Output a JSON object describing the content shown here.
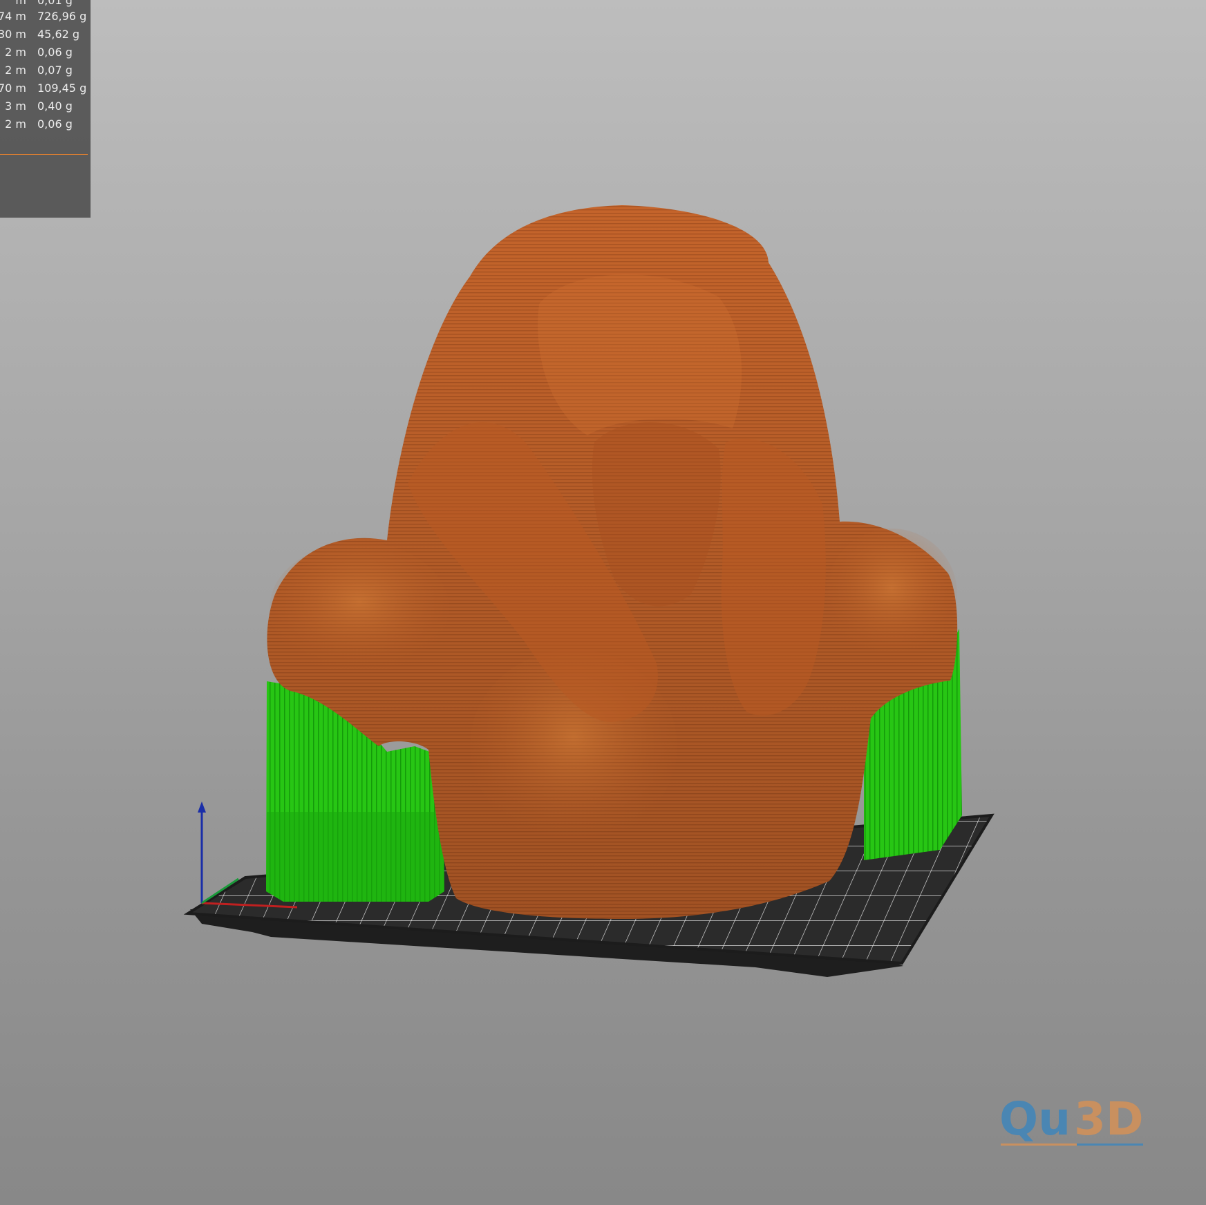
{
  "statistics_panel": {
    "rows": [
      {
        "length": "m",
        "weight": "0,01 g"
      },
      {
        "length": ",74 m",
        "weight": "726,96 g"
      },
      {
        "length": "30 m",
        "weight": "45,62 g"
      },
      {
        "length": "2 m",
        "weight": "0,06 g"
      },
      {
        "length": "2 m",
        "weight": "0,07 g"
      },
      {
        "length": "70 m",
        "weight": "109,45 g"
      },
      {
        "length": "3 m",
        "weight": "0,40 g"
      },
      {
        "length": "2 m",
        "weight": "0,06 g"
      }
    ],
    "separator_color": "#e2802f"
  },
  "viewport": {
    "object": "sliced-bust-preview",
    "colors": {
      "perimeter": "#c8642a",
      "support": "#22c20f",
      "bed": "#2b2b2b",
      "grid": "#e8e8e8",
      "axis_z": "#1a2ea8",
      "axis_x": "#c02020",
      "axis_y": "#1a9a3a"
    }
  },
  "logo": {
    "text_part1": "Qu",
    "text_part2": "3D",
    "color1": "#4a86b3",
    "color2": "#c9905f"
  }
}
